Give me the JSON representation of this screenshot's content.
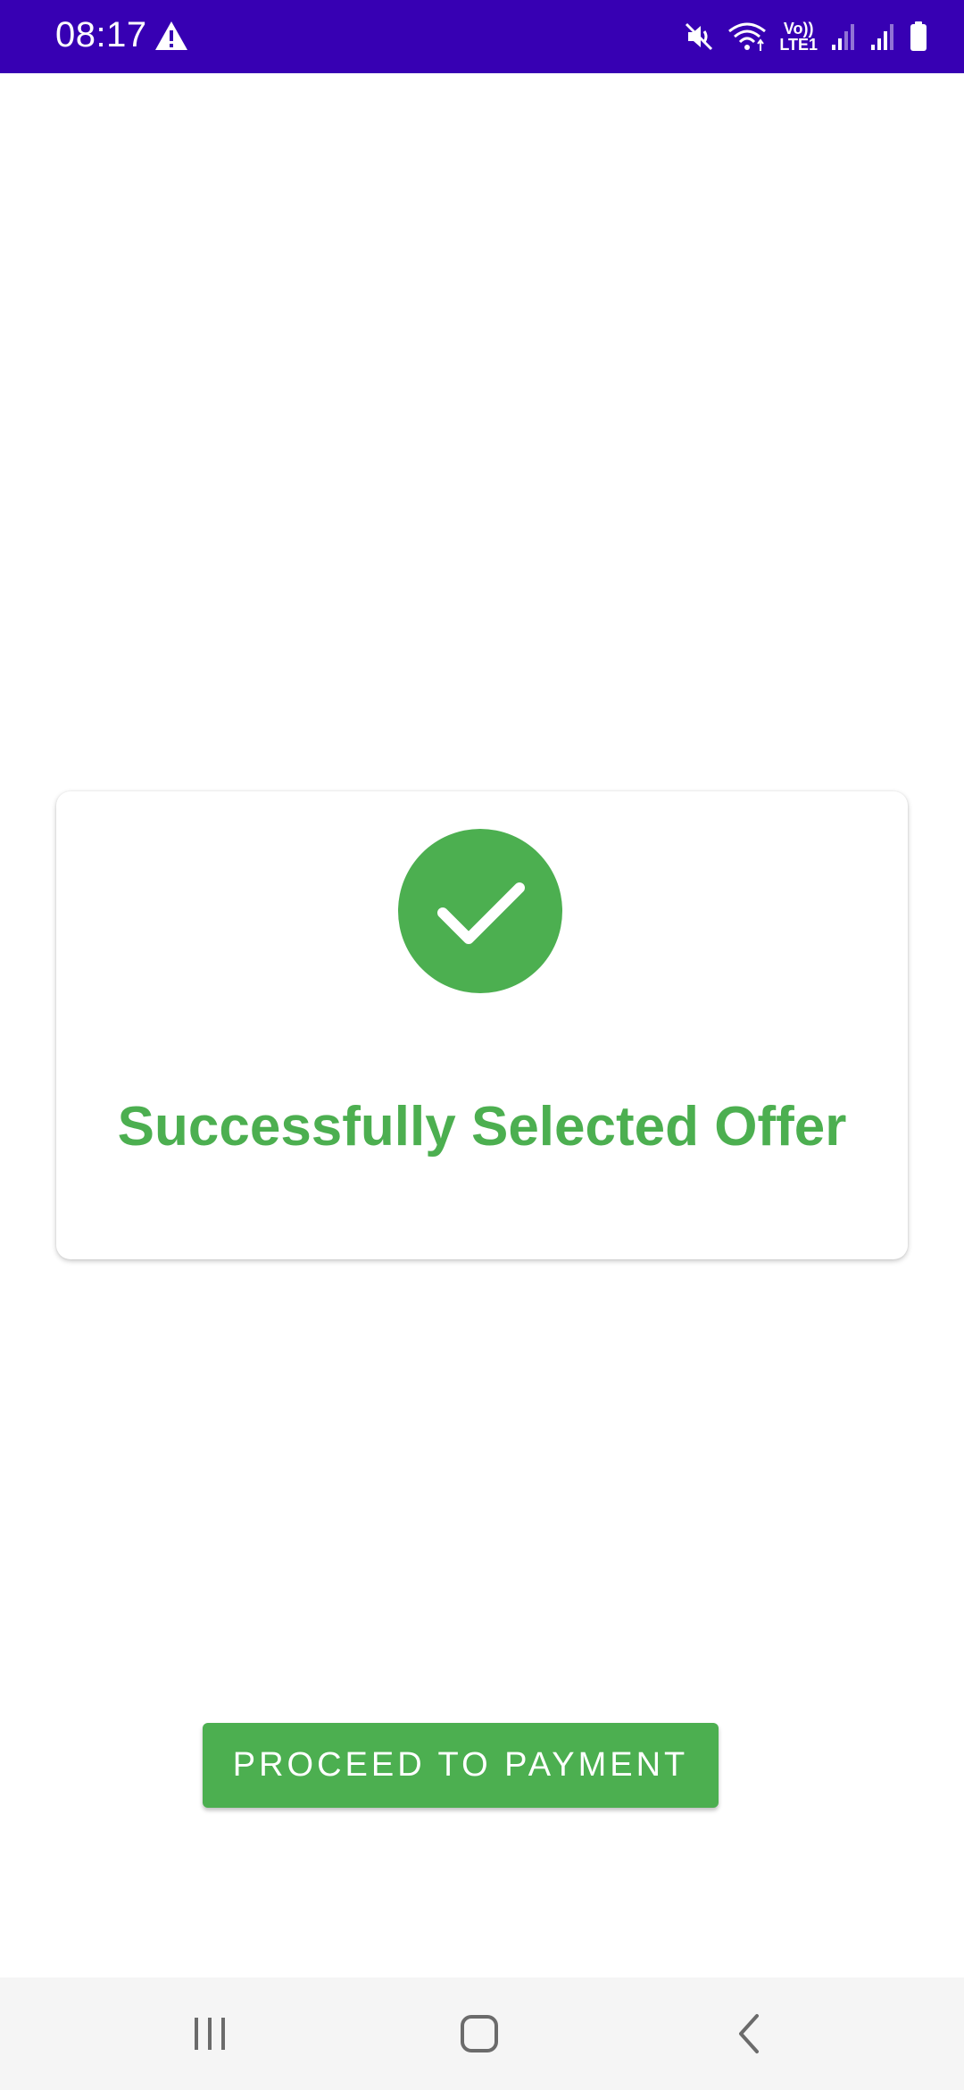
{
  "status_bar": {
    "time": "08:17",
    "lte_top": "Vo))",
    "lte_bottom": "LTE1",
    "background": "#3700b3",
    "icons": [
      "warning-icon",
      "mute-icon",
      "wifi-icon",
      "signal-icon",
      "signal-icon",
      "battery-icon"
    ]
  },
  "card": {
    "icon": "check-icon",
    "title": "Successfully Selected Offer",
    "accent_color": "#4caf50"
  },
  "actions": {
    "proceed_label": "PROCEED TO PAYMENT"
  },
  "nav_bar": {
    "icons": [
      "recents-icon",
      "home-icon",
      "back-icon"
    ]
  }
}
